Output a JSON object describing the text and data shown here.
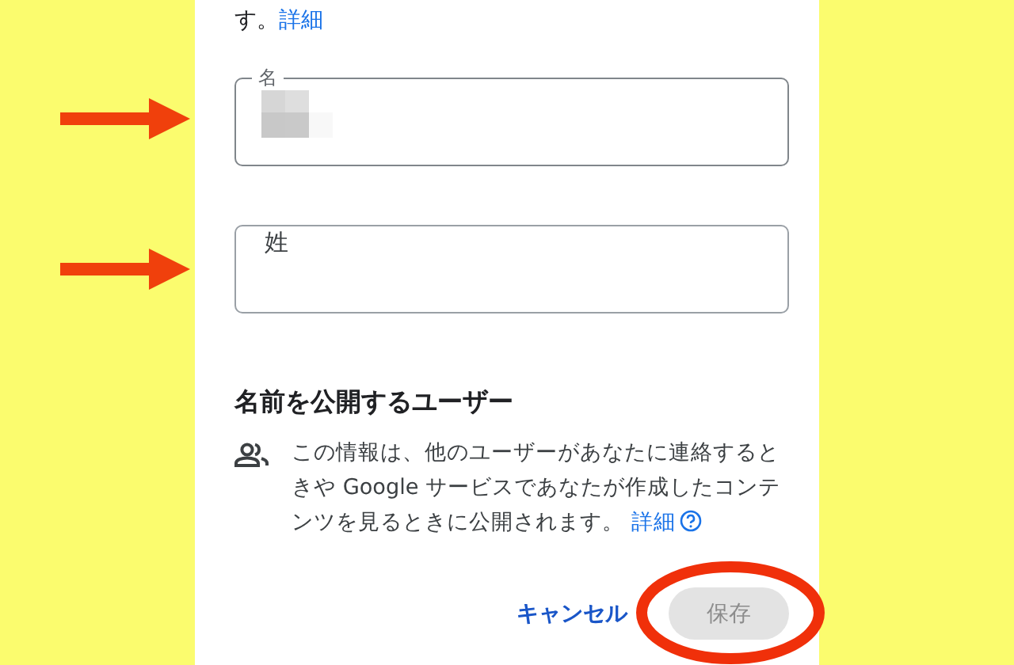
{
  "intro": {
    "text": "す。",
    "link": "詳細"
  },
  "fields": [
    {
      "label": "名",
      "kind": "redacted"
    },
    {
      "placeholder": "姓",
      "kind": "empty"
    }
  ],
  "visibility": {
    "heading": "名前を公開するユーザー",
    "text": "この情報は、他のユーザーがあなたに連絡するときや Google サービスであなたが作成したコンテンツを見るときに公開されます。",
    "link": "詳細"
  },
  "buttons": [
    {
      "label": "キャンセル",
      "kind": "text",
      "disabled": false
    },
    {
      "label": "保存",
      "kind": "filled",
      "disabled": true
    }
  ],
  "annotations": [
    {
      "kind": "arrow"
    },
    {
      "kind": "arrow"
    },
    {
      "kind": "circle"
    }
  ]
}
